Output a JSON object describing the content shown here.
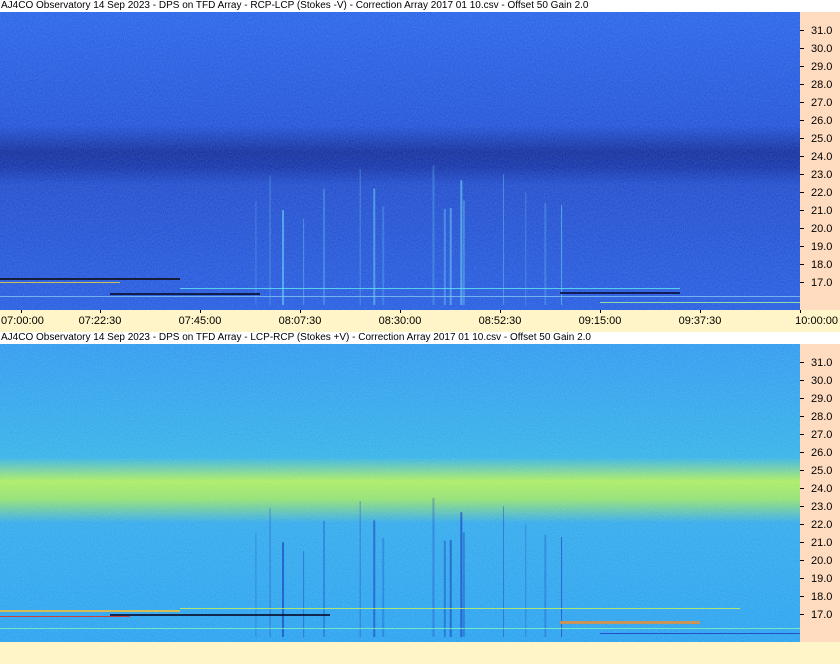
{
  "panels": [
    {
      "id": "top",
      "title": "AJ4CO Observatory 14 Sep 2023 -  DPS on TFD Array  -  RCP-LCP (Stokes -V)  -  Correction Array 2017 01 10.csv  -  Offset 50  Gain 2.0",
      "palette": "dark-blue"
    },
    {
      "id": "bottom",
      "title": "AJ4CO Observatory 14 Sep 2023 -  DPS on TFD Array  -  LCP-RCP (Stokes +V)  -  Correction Array 2017 01 10.csv  -  Offset 50  Gain 2.0",
      "palette": "cyan-green"
    }
  ],
  "frequency_labels": [
    "31.0",
    "30.0",
    "29.0",
    "28.0",
    "27.0",
    "26.0",
    "25.0",
    "24.0",
    "23.0",
    "22.0",
    "21.0",
    "20.0",
    "19.0",
    "18.0",
    "17.0"
  ],
  "time_labels": [
    "07:00:00",
    "07:22:30",
    "07:45:00",
    "08:07:30",
    "08:30:00",
    "08:52:30",
    "09:15:00",
    "09:37:30",
    "10:00:00"
  ],
  "colors": {
    "background": "#FFF5C8",
    "freq_axis": "#FFDCC0",
    "top_base": "#1E5AE6",
    "top_band": "#0A2A9A",
    "bottom_base": "#28A0F0",
    "bottom_band": "#B4F050"
  }
}
